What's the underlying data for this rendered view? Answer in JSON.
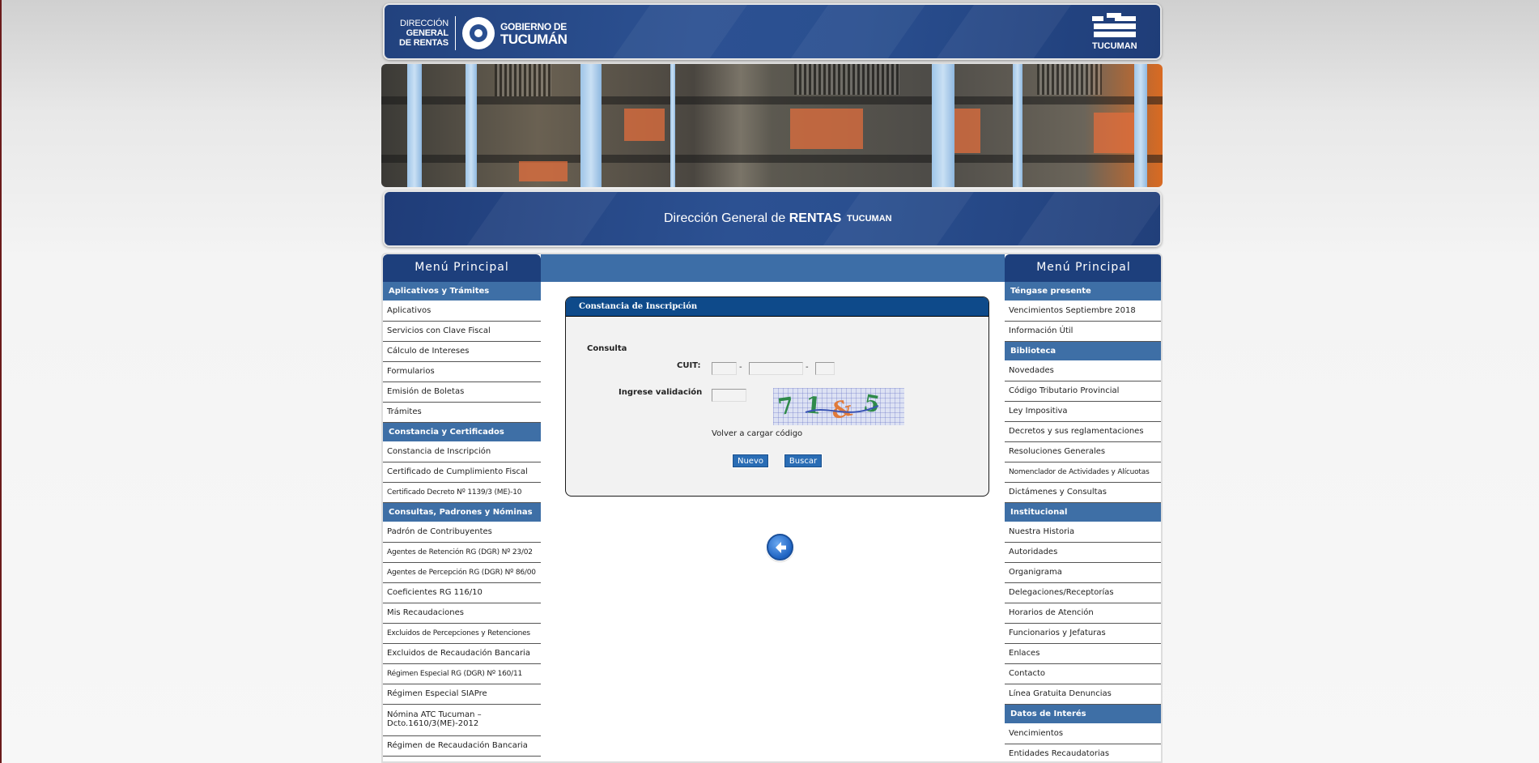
{
  "header": {
    "dgr_line1": "DIRECCIÓN",
    "dgr_line2": "GENERAL",
    "dgr_line3": "DE RENTAS",
    "gob_line1": "GOBIERNO DE",
    "gob_line2": "TUCUMÁN",
    "right_logo_text": "TUCUMAN"
  },
  "title_bar": {
    "prefix": "Dirección General de ",
    "bold": "RENTAS",
    "suffix": "TUCUMAN"
  },
  "left_menu": {
    "title": "Menú Principal",
    "sections": [
      {
        "heading": "Aplicativos y Trámites",
        "items": [
          "Aplicativos",
          "Servicios con Clave Fiscal",
          "Cálculo de Intereses",
          "Formularios",
          "Emisión de Boletas",
          "Trámites"
        ]
      },
      {
        "heading": "Constancia y Certificados",
        "items": [
          "Constancia de Inscripción",
          "Certificado de Cumplimiento Fiscal",
          "Certificado Decreto Nº 1139/3 (ME)-10"
        ]
      },
      {
        "heading": "Consultas, Padrones y Nóminas",
        "items": [
          "Padrón de Contribuyentes",
          "Agentes de Retención RG (DGR) Nº 23/02",
          "Agentes de Percepción RG (DGR) Nº 86/00",
          "Coeficientes RG 116/10",
          "Mis Recaudaciones",
          "Excluidos de Percepciones y Retenciones",
          "Excluidos de Recaudación Bancaria",
          "Régimen Especial RG (DGR) Nº 160/11",
          "Régimen Especial SIAPre",
          "Nómina ATC Tucuman – Dcto.1610/3(ME)-2012",
          "Régimen de Recaudación Bancaria"
        ]
      }
    ]
  },
  "right_menu": {
    "title": "Menú Principal",
    "sections": [
      {
        "heading": "Téngase presente",
        "items": [
          "Vencimientos Septiembre 2018",
          "Información Útil"
        ]
      },
      {
        "heading": "Biblioteca",
        "items": [
          "Novedades",
          "Código Tributario Provincial",
          "Ley Impositiva",
          "Decretos y sus reglamentaciones",
          "Resoluciones Generales",
          "Nomenclador de Actividades y Alícuotas",
          "Dictámenes y Consultas"
        ]
      },
      {
        "heading": "Institucional",
        "items": [
          "Nuestra Historia",
          "Autoridades",
          "Organigrama",
          "Delegaciones/Receptorías",
          "Horarios de Atención",
          "Funcionarios y Jefaturas",
          "Enlaces",
          "Contacto",
          "Línea Gratuita Denuncias"
        ]
      },
      {
        "heading": "Datos de Interés",
        "items": [
          "Vencimientos",
          "Entidades Recaudatorias"
        ]
      }
    ]
  },
  "form": {
    "title": "Constancia de Inscripción",
    "section_label": "Consulta",
    "cuit_label": "CUIT:",
    "cuit_part1": "",
    "cuit_part2": "",
    "cuit_part3": "",
    "cuit_separator": "-",
    "validation_label": "Ingrese validación",
    "validation_value": "",
    "captcha_chars": [
      "7",
      "1",
      "&",
      "5"
    ],
    "captcha_colors": [
      "#2f8a4a",
      "#2f8a4a",
      "#e07a3a",
      "#2f8a4a"
    ],
    "reload_link": "Volver a cargar código",
    "new_button": "Nuevo",
    "search_button": "Buscar"
  },
  "colors": {
    "header_blue": "#2a4f90",
    "menu_head": "#1d3f7c",
    "section_head": "#3e6fa6",
    "form_head": "#0e4a8a",
    "button": "#2a6db5"
  },
  "icons": {
    "back": "arrow-left-circle-icon",
    "header_logo": "sun-logo-icon",
    "right_logo": "tucuman-stacked-bars-icon"
  }
}
